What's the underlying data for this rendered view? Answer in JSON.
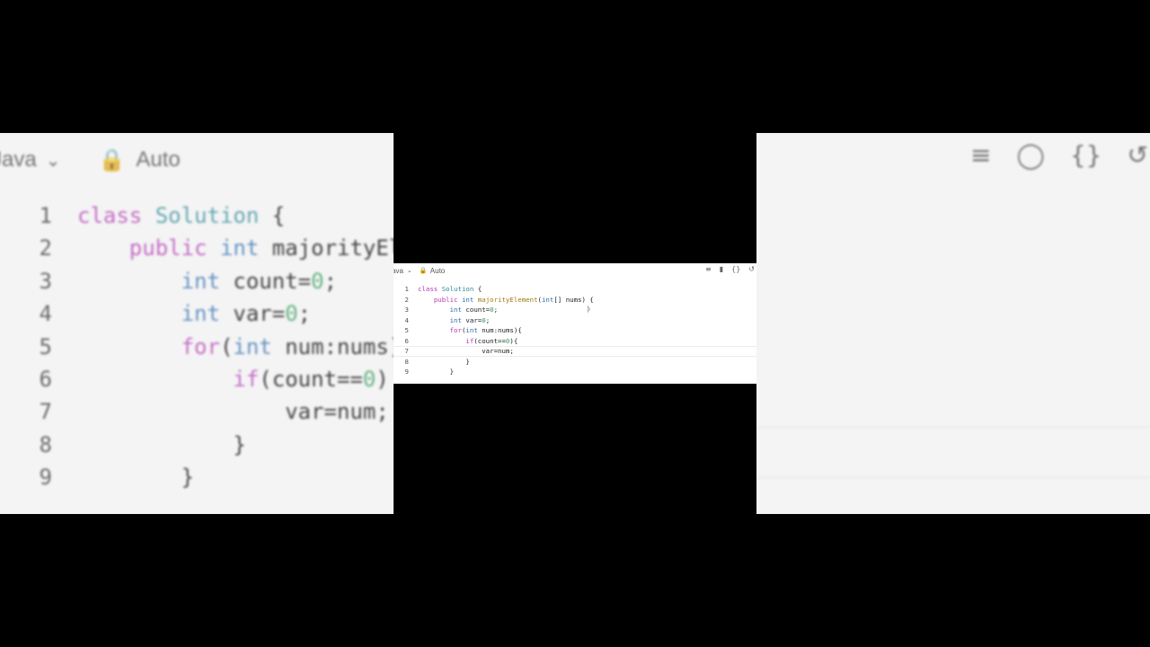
{
  "editor": {
    "language": "Java",
    "language_visible": "ava",
    "mode": "Auto",
    "icons": [
      "format-icon",
      "bookmark-icon",
      "braces-icon",
      "undo-icon"
    ]
  },
  "code_lines": [
    {
      "num": "1",
      "text": "class Solution {"
    },
    {
      "num": "2",
      "text": "    public int majorityElement(int[] nums) {"
    },
    {
      "num": "3",
      "text": "        int count=0;"
    },
    {
      "num": "4",
      "text": "        int var=0;"
    },
    {
      "num": "5",
      "text": "        for(int num:nums){"
    },
    {
      "num": "6",
      "text": "            if(count==0){"
    },
    {
      "num": "7",
      "text": "                var=num;"
    },
    {
      "num": "8",
      "text": "            }"
    },
    {
      "num": "9",
      "text": "        }"
    }
  ],
  "bg_code_lines": [
    "class Solution {",
    "    public int majorityEl",
    "        int count=0;",
    "        int var=0;",
    "        for(int num:nums]",
    "            if(count==0)",
    "                var=num;",
    "            }",
    "        }"
  ]
}
